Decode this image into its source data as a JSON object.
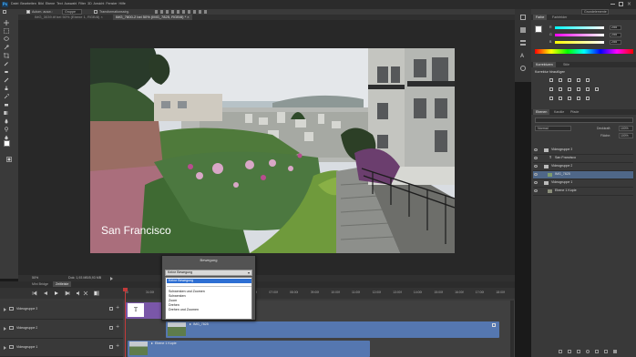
{
  "menubar": {
    "items": [
      "Ps",
      "Datei",
      "Bearbeiten",
      "Bild",
      "Ebene",
      "Text",
      "Auswahl",
      "Filter",
      "3D",
      "Ansicht",
      "Fenster",
      "Hilfe"
    ]
  },
  "options_bar": {
    "auto_select_label": "Autom. ausw.:",
    "auto_select_value": "Gruppe",
    "transform_label": "Transformationsstrg.",
    "workspace": "Grundelemente"
  },
  "document_tabs": [
    {
      "label": "IMG_3039.tif bei 50% (Ebene 1, RGB/8)",
      "active": false
    },
    {
      "label": "IMG_7800-2 bei 50% (IMG_7825, RGB/8) *",
      "active": true
    }
  ],
  "canvas": {
    "overlay_text": "San Francisco"
  },
  "status_bar": {
    "zoom": "50%",
    "doc_info": "Dok: 1,93 MB/5,93 MB"
  },
  "right_panels": {
    "color_tabs": [
      "Farbe",
      "Farbfelder"
    ],
    "color_sliders": [
      {
        "label": "R",
        "value": "255",
        "gradient": "linear-gradient(90deg,#00ffff,#ffffff)"
      },
      {
        "label": "G",
        "value": "255",
        "gradient": "linear-gradient(90deg,#ff00ff,#ffffff)"
      },
      {
        "label": "B",
        "value": "255",
        "gradient": "linear-gradient(90deg,#ffff00,#ffffff)"
      }
    ],
    "adjust_tabs": [
      "Korrekturen",
      "Stile"
    ],
    "adjust_title": "Korrektur hinzufügen",
    "layers_tabs": [
      "Ebenen",
      "Kanäle",
      "Pfade"
    ],
    "blend_mode": "Normal",
    "opacity_label": "Deckkraft:",
    "opacity_value": "100%",
    "fill_label": "Fläche:",
    "fill_value": "100%",
    "layers": [
      {
        "name": "Videogruppe 3",
        "type": "group",
        "selected": false
      },
      {
        "name": "San Francisco",
        "type": "text",
        "selected": false
      },
      {
        "name": "Videogruppe 2",
        "type": "group",
        "selected": false
      },
      {
        "name": "IMG_7825",
        "type": "image",
        "selected": true
      },
      {
        "name": "Videogruppe 1",
        "type": "group",
        "selected": false
      },
      {
        "name": "Ebene 1 Kopie",
        "type": "image",
        "selected": false
      }
    ]
  },
  "timeline": {
    "tabs": [
      "Mini Bridge",
      "Zeitleiste"
    ],
    "ruler_ticks": [
      "00",
      "01:00f",
      "02:00f",
      "03:00f",
      "04:00f",
      "05:00f",
      "06:00f",
      "07:00f",
      "08:00f",
      "09:00f",
      "10:00f",
      "11:00f",
      "12:00f",
      "13:00f",
      "14:00f",
      "15:00f",
      "16:00f",
      "17:00f",
      "18:00f"
    ],
    "tracks": [
      {
        "name": "Videogruppe 3",
        "clip": "T",
        "clip_color": "#7a57a8"
      },
      {
        "name": "Videogruppe 2",
        "clip": "IMG_7825",
        "clip_color": "#5577b0"
      },
      {
        "name": "Videogruppe 1",
        "clip": "Ebene 1 Kopie",
        "clip_color": "#5577b0"
      }
    ]
  },
  "popup": {
    "title": "Bewegung",
    "selected_value": "Keine Bewegung",
    "options": [
      "Keine Bewegung",
      "Schwenken und Zoomen",
      "Schwenken",
      "Zoom",
      "Drehen",
      "Drehen und Zoomen"
    ]
  }
}
